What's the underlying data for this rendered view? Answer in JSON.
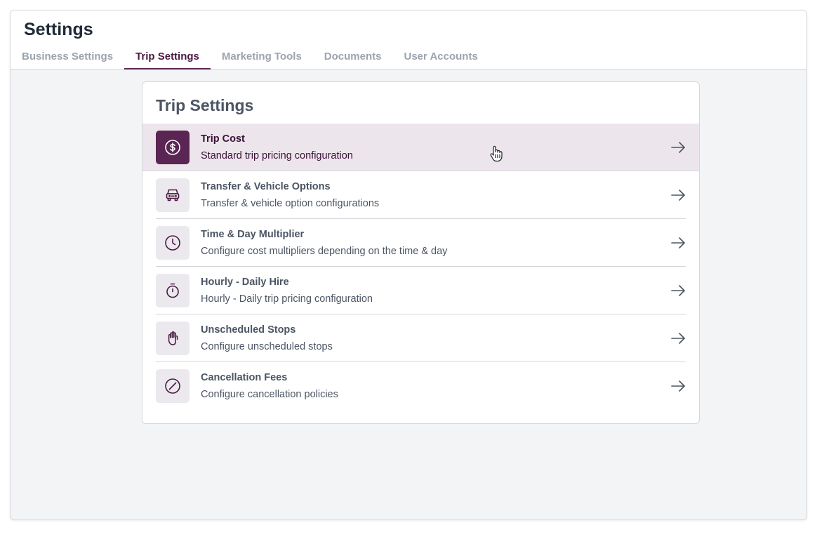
{
  "header": {
    "title": "Settings",
    "tabs": [
      {
        "label": "Business Settings",
        "active": false
      },
      {
        "label": "Trip Settings",
        "active": true
      },
      {
        "label": "Marketing Tools",
        "active": false
      },
      {
        "label": "Documents",
        "active": false
      },
      {
        "label": "User Accounts",
        "active": false
      }
    ]
  },
  "card": {
    "title": "Trip Settings",
    "items": [
      {
        "icon": "dollar-circle-icon",
        "title": "Trip Cost",
        "description": "Standard trip pricing configuration",
        "hovered": true
      },
      {
        "icon": "car-icon",
        "title": "Transfer & Vehicle Options",
        "description": "Transfer & vehicle option configurations"
      },
      {
        "icon": "clock-icon",
        "title": "Time & Day Multiplier",
        "description": "Configure cost multipliers depending on the time & day"
      },
      {
        "icon": "stopwatch-icon",
        "title": "Hourly - Daily Hire",
        "description": "Hourly - Daily trip pricing configuration"
      },
      {
        "icon": "hand-icon",
        "title": "Unscheduled Stops",
        "description": "Configure unscheduled stops"
      },
      {
        "icon": "ban-icon",
        "title": "Cancellation Fees",
        "description": "Configure cancellation policies"
      }
    ]
  },
  "colors": {
    "accent": "#5a2552",
    "accent_text": "#4a1942",
    "hover_bg": "#ece6ec",
    "icon_bg": "#ece9ee"
  }
}
